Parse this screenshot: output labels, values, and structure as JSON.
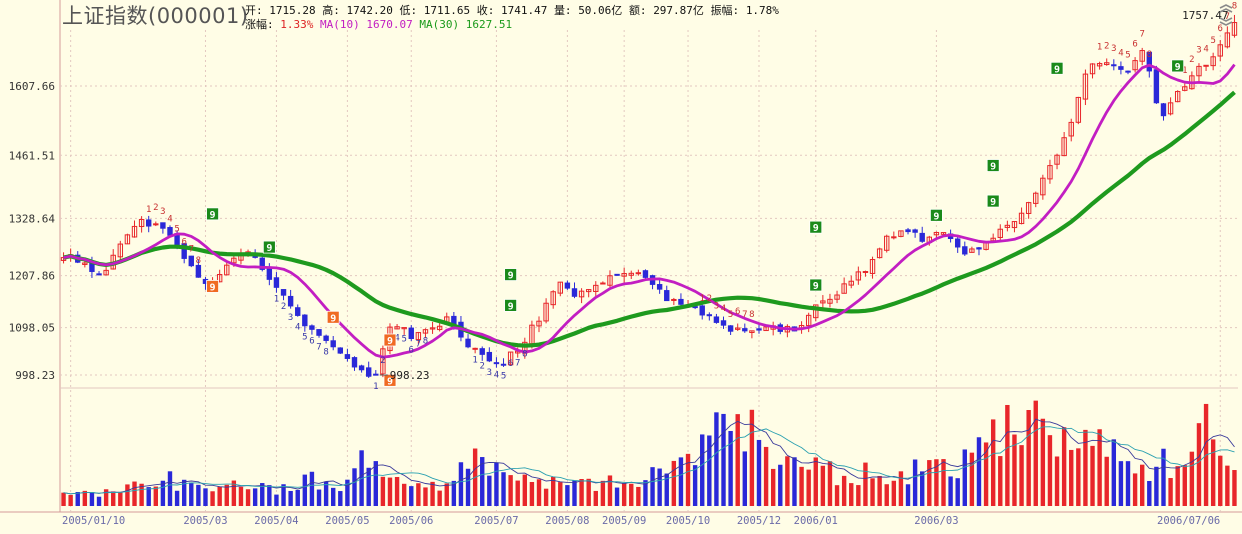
{
  "header": {
    "title": "上证指数(000001)",
    "open_label": "开:",
    "open": "1715.28",
    "high_label": "高:",
    "high": "1742.20",
    "low_label": "低:",
    "low": "1711.65",
    "close_label": "收:",
    "close": "1741.47",
    "volume_label": "量:",
    "volume": "50.06亿",
    "amount_label": "额:",
    "amount": "297.87亿",
    "amplitude_label": "振幅:",
    "amplitude": "1.78%",
    "change_label": "涨幅:",
    "change": "1.33%",
    "ma10_label": "MA(10)",
    "ma10": "1670.07",
    "ma30_label": "MA(30)",
    "ma30": "1627.51"
  },
  "colors": {
    "background": "#fffde6",
    "up": "#e8262a",
    "down": "#2a28d8",
    "ma_short": "#c21ec2",
    "ma_long": "#1e9a1e",
    "grid": "#e3c8c0",
    "axis": "#d49a9a",
    "marker_green": "#1a8a1a",
    "marker_orange": "#f06a22",
    "tick_text": "#333333",
    "date_text": "#6a6aa8"
  },
  "icons": [
    "scroll-up-icon",
    "scroll-down-icon"
  ],
  "chart_data": {
    "type": "candlestick",
    "y_ticks": [
      998.23,
      1098.05,
      1207.86,
      1328.64,
      1461.51,
      1607.66
    ],
    "y_tick_labels": [
      "998.23",
      "1098.05",
      "1207.86",
      "1328.64",
      "1461.51",
      "1607.66"
    ],
    "ylim": [
      960,
      1790
    ],
    "x_tick_labels": [
      "2005/01/10",
      "2005/03",
      "2005/04",
      "2005/05",
      "2005/06",
      "2005/07",
      "2005/08",
      "2005/09",
      "2005/10",
      "2005/12",
      "2006/01",
      "2006/03",
      "2006/07/06"
    ],
    "annotations": [
      {
        "text": "998.23",
        "kind": "low",
        "price": 998.23,
        "date": "2005/06"
      },
      {
        "text": "1757.47",
        "kind": "high",
        "price": 1757.47,
        "date": "2006/07/06"
      }
    ],
    "price_path": [
      {
        "x": "2005/01/10",
        "y": 1250
      },
      {
        "x": "2005/01",
        "y": 1235
      },
      {
        "x": "2005/01",
        "y": 1205
      },
      {
        "x": "2005/02",
        "y": 1262
      },
      {
        "x": "2005/02",
        "y": 1318
      },
      {
        "x": "2005/03",
        "y": 1320
      },
      {
        "x": "2005/03",
        "y": 1285
      },
      {
        "x": "2005/03",
        "y": 1222
      },
      {
        "x": "2005/04",
        "y": 1185
      },
      {
        "x": "2005/04",
        "y": 1240
      },
      {
        "x": "2005/04",
        "y": 1262
      },
      {
        "x": "2005/04",
        "y": 1215
      },
      {
        "x": "2005/05",
        "y": 1160
      },
      {
        "x": "2005/05",
        "y": 1110
      },
      {
        "x": "2005/05",
        "y": 1080
      },
      {
        "x": "2005/05",
        "y": 1045
      },
      {
        "x": "2005/06",
        "y": 1010
      },
      {
        "x": "2005/06",
        "y": 998
      },
      {
        "x": "2005/06",
        "y": 1115
      },
      {
        "x": "2005/06",
        "y": 1080
      },
      {
        "x": "2005/06",
        "y": 1100
      },
      {
        "x": "2005/07",
        "y": 1115
      },
      {
        "x": "2005/07",
        "y": 1070
      },
      {
        "x": "2005/07",
        "y": 1030
      },
      {
        "x": "2005/07",
        "y": 1025
      },
      {
        "x": "2005/07",
        "y": 1060
      },
      {
        "x": "2005/08",
        "y": 1120
      },
      {
        "x": "2005/08",
        "y": 1200
      },
      {
        "x": "2005/08",
        "y": 1170
      },
      {
        "x": "2005/08",
        "y": 1185
      },
      {
        "x": "2005/09",
        "y": 1205
      },
      {
        "x": "2005/09",
        "y": 1220
      },
      {
        "x": "2005/09",
        "y": 1195
      },
      {
        "x": "2005/09",
        "y": 1160
      },
      {
        "x": "2005/10",
        "y": 1150
      },
      {
        "x": "2005/10",
        "y": 1125
      },
      {
        "x": "2005/10",
        "y": 1100
      },
      {
        "x": "2005/11",
        "y": 1090
      },
      {
        "x": "2005/11",
        "y": 1100
      },
      {
        "x": "2005/11",
        "y": 1098
      },
      {
        "x": "2005/12",
        "y": 1090
      },
      {
        "x": "2005/12",
        "y": 1135
      },
      {
        "x": "2005/12",
        "y": 1165
      },
      {
        "x": "2006/01",
        "y": 1195
      },
      {
        "x": "2006/01",
        "y": 1230
      },
      {
        "x": "2006/01",
        "y": 1285
      },
      {
        "x": "2006/02",
        "y": 1300
      },
      {
        "x": "2006/02",
        "y": 1285
      },
      {
        "x": "2006/02",
        "y": 1300
      },
      {
        "x": "2006/03",
        "y": 1255
      },
      {
        "x": "2006/03",
        "y": 1270
      },
      {
        "x": "2006/03",
        "y": 1300
      },
      {
        "x": "2006/04",
        "y": 1320
      },
      {
        "x": "2006/04",
        "y": 1380
      },
      {
        "x": "2006/04",
        "y": 1440
      },
      {
        "x": "2006/05",
        "y": 1520
      },
      {
        "x": "2006/05",
        "y": 1660
      },
      {
        "x": "2006/05",
        "y": 1655
      },
      {
        "x": "2006/05",
        "y": 1630
      },
      {
        "x": "2006/06",
        "y": 1680
      },
      {
        "x": "2006/06",
        "y": 1540
      },
      {
        "x": "2006/06",
        "y": 1600
      },
      {
        "x": "2006/06",
        "y": 1640
      },
      {
        "x": "2006/07",
        "y": 1680
      },
      {
        "x": "2006/07/06",
        "y": 1741
      }
    ],
    "series": [
      {
        "name": "MA(10)",
        "last_value": 1670.07
      },
      {
        "name": "MA(30)",
        "last_value": 1627.51
      }
    ],
    "volume_path": [
      [
        0,
        12
      ],
      [
        8,
        14
      ],
      [
        14,
        28
      ],
      [
        20,
        16
      ],
      [
        26,
        22
      ],
      [
        30,
        14
      ],
      [
        34,
        30
      ],
      [
        38,
        18
      ],
      [
        42,
        46
      ],
      [
        46,
        22
      ],
      [
        50,
        26
      ],
      [
        54,
        18
      ],
      [
        58,
        56
      ],
      [
        62,
        40
      ],
      [
        66,
        34
      ],
      [
        70,
        24
      ],
      [
        74,
        28
      ],
      [
        78,
        22
      ],
      [
        84,
        36
      ],
      [
        90,
        62
      ],
      [
        94,
        80
      ],
      [
        98,
        84
      ],
      [
        100,
        52
      ],
      [
        104,
        40
      ],
      [
        112,
        32
      ],
      [
        120,
        38
      ],
      [
        126,
        46
      ],
      [
        130,
        64
      ],
      [
        134,
        82
      ],
      [
        138,
        100
      ],
      [
        142,
        70
      ],
      [
        146,
        60
      ],
      [
        150,
        52
      ],
      [
        154,
        40
      ],
      [
        158,
        56
      ],
      [
        162,
        86
      ],
      [
        165,
        62
      ]
    ],
    "markers": [
      {
        "text": "9",
        "color": "green",
        "x": "2005/03",
        "y": 1338
      },
      {
        "text": "9",
        "color": "green",
        "x": "2005/04",
        "y": 1268
      },
      {
        "text": "9",
        "color": "orange",
        "x": "2005/03",
        "y": 1185
      },
      {
        "text": "9",
        "color": "orange",
        "x": "2005/05",
        "y": 1120
      },
      {
        "text": "9",
        "color": "orange",
        "x": "2005/06",
        "y": 1072
      },
      {
        "text": "9",
        "color": "orange",
        "x": "2005/06",
        "y": 987
      },
      {
        "text": "9",
        "color": "green",
        "x": "2005/08",
        "y": 1145
      },
      {
        "text": "9",
        "color": "green",
        "x": "2005/08",
        "y": 1210
      },
      {
        "text": "9",
        "color": "green",
        "x": "2006/01",
        "y": 1188
      },
      {
        "text": "9",
        "color": "green",
        "x": "2006/01",
        "y": 1310
      },
      {
        "text": "9",
        "color": "green",
        "x": "2006/03",
        "y": 1335
      },
      {
        "text": "9",
        "color": "green",
        "x": "2006/04",
        "y": 1365
      },
      {
        "text": "9",
        "color": "green",
        "x": "2006/04",
        "y": 1440
      },
      {
        "text": "9",
        "color": "green",
        "x": "2006/05",
        "y": 1645
      },
      {
        "text": "9",
        "color": "green",
        "x": "2006/07",
        "y": 1650
      }
    ],
    "grid": true
  }
}
